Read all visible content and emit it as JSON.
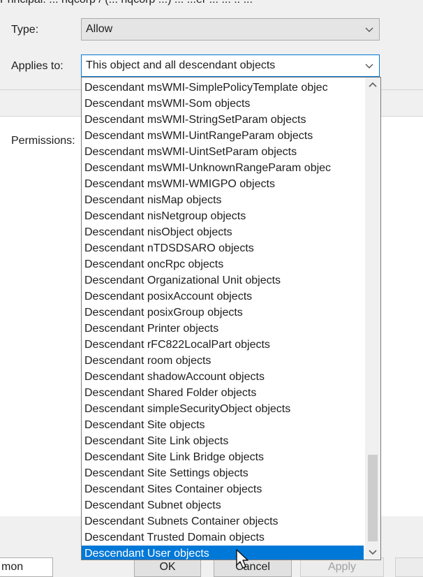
{
  "header": {
    "clipped_text": "Principal:   ... hqcorp / (... hqcorp ...) ... ...er ... ... .. ..."
  },
  "form": {
    "type_label": "Type:",
    "type_value": "Allow",
    "applies_label": "Applies to:",
    "applies_value": "This object and all descendant objects",
    "permissions_label": "Permissions:"
  },
  "dropdown": {
    "items": [
      "Descendant msWMI-SimplePolicyTemplate objec",
      "Descendant msWMI-Som objects",
      "Descendant msWMI-StringSetParam objects",
      "Descendant msWMI-UintRangeParam objects",
      "Descendant msWMI-UintSetParam objects",
      "Descendant msWMI-UnknownRangeParam objec",
      "Descendant msWMI-WMIGPO objects",
      "Descendant nisMap objects",
      "Descendant nisNetgroup objects",
      "Descendant nisObject objects",
      "Descendant nTDSDSARO objects",
      "Descendant oncRpc objects",
      "Descendant Organizational Unit objects",
      "Descendant posixAccount objects",
      "Descendant posixGroup objects",
      "Descendant Printer objects",
      "Descendant rFC822LocalPart objects",
      "Descendant room objects",
      "Descendant shadowAccount objects",
      "Descendant Shared Folder objects",
      "Descendant simpleSecurityObject objects",
      "Descendant Site objects",
      "Descendant Site Link objects",
      "Descendant Site Link Bridge objects",
      "Descendant Site Settings objects",
      "Descendant Sites Container objects",
      "Descendant Subnet objects",
      "Descendant Subnets Container objects",
      "Descendant Trusted Domain objects",
      "Descendant User objects"
    ],
    "selected_index": 29
  },
  "bottom": {
    "partial_field_text": "mon",
    "ok_label": "OK",
    "cancel_label": "Cancel",
    "apply_label": "Apply"
  },
  "colors": {
    "selection": "#0078d7",
    "focus_border": "#0078d7"
  }
}
